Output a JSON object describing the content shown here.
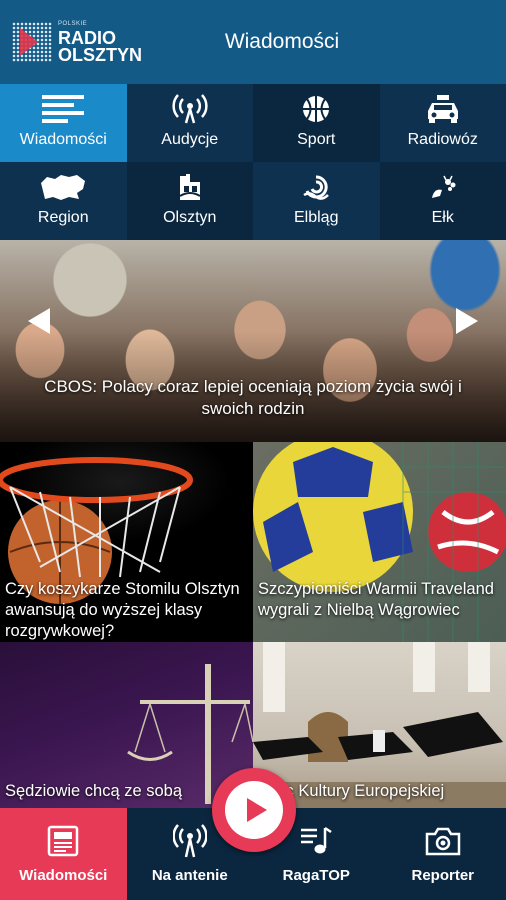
{
  "header": {
    "logo_small": "POLSKIE",
    "logo_line1": "RADIO",
    "logo_line2": "OLSZTYN",
    "title": "Wiadomości"
  },
  "categories": [
    {
      "label": "Wiadomości",
      "icon": "news-lines-icon",
      "active": true
    },
    {
      "label": "Audycje",
      "icon": "broadcast-icon"
    },
    {
      "label": "Sport",
      "icon": "basketball-icon"
    },
    {
      "label": "Radiowóz",
      "icon": "car-icon"
    },
    {
      "label": "Region",
      "icon": "region-map-icon"
    },
    {
      "label": "Olsztyn",
      "icon": "olsztyn-city-icon"
    },
    {
      "label": "Elbląg",
      "icon": "elblag-icon"
    },
    {
      "label": "Ełk",
      "icon": "elk-icon"
    }
  ],
  "hero": {
    "caption": "CBOS: Polacy coraz lepiej oceniają poziom życia swój i swoich rodzin"
  },
  "tiles": [
    {
      "caption": "Czy koszykarze Stomilu Olsztyn awansują do wyższej klasy rozgrywkowej?"
    },
    {
      "caption": "Szczypiomiści Warmii Traveland wygrali z Nielbą Wągrowiec"
    },
    {
      "caption": "Sędziowie chcą ze sobą"
    },
    {
      "caption": "rbiec Kultury Europejskiej"
    }
  ],
  "bottom_nav": [
    {
      "label": "Wiadomości",
      "icon": "newspaper-icon",
      "active": true
    },
    {
      "label": "Na antenie",
      "icon": "antenna-icon"
    },
    {
      "label": "RagaTOP",
      "icon": "music-list-icon"
    },
    {
      "label": "Reporter",
      "icon": "camera-icon"
    }
  ],
  "colors": {
    "header": "#145a87",
    "active_category": "#1a8ac9",
    "accent": "#e63a56",
    "background": "#0b2740"
  }
}
